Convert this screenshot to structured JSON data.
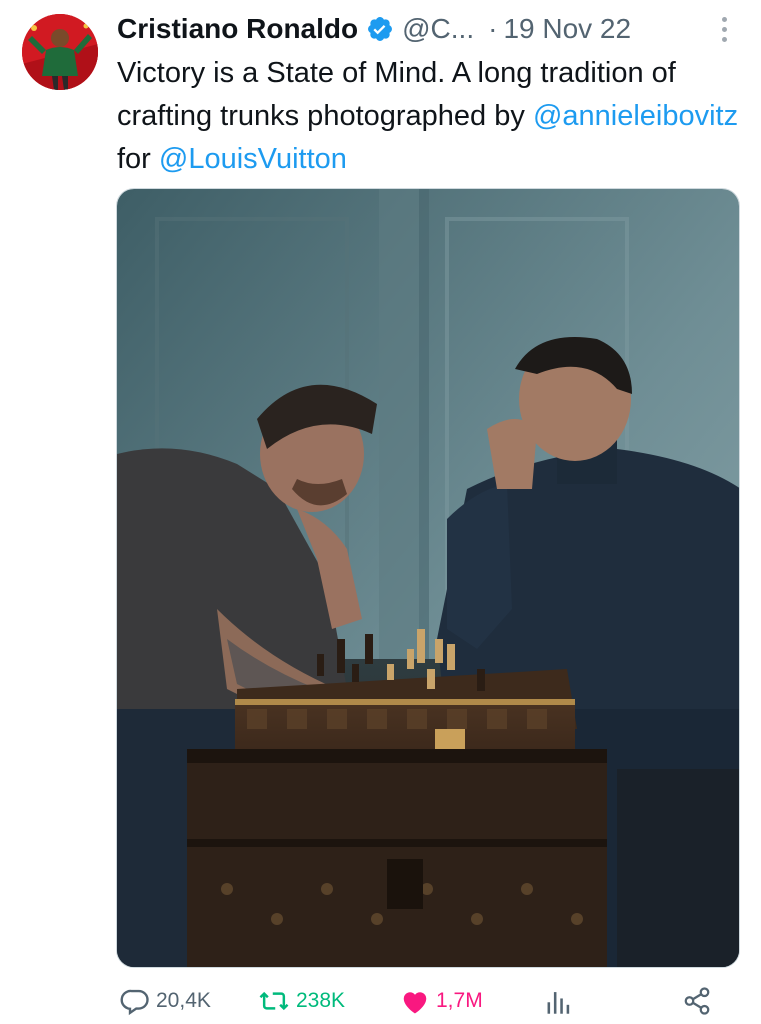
{
  "tweet": {
    "author_name": "Cristiano Ronaldo",
    "handle": "@C...",
    "separator": "·",
    "date": "19 Nov 22",
    "text_parts": [
      "Victory is a State of Mind. A long tradition of crafting trunks photographed by ",
      "@annieleibovitz",
      " for ",
      "@LouisVuitton"
    ],
    "media_alt": "Photo: two men playing chess on a Louis Vuitton trunk"
  },
  "actions": {
    "replies": "20,4K",
    "retweets": "238K",
    "likes": "1,7M"
  },
  "colors": {
    "accent": "#1d9bf0",
    "like": "#f91880",
    "retweet": "#00ba7c",
    "secondary_text": "#536471"
  },
  "icons": {
    "verified": "verified-badge-icon",
    "more": "more-options-icon",
    "reply": "reply-icon",
    "retweet": "retweet-icon",
    "like": "heart-icon",
    "views": "views-bar-chart-icon",
    "share": "share-icon"
  }
}
